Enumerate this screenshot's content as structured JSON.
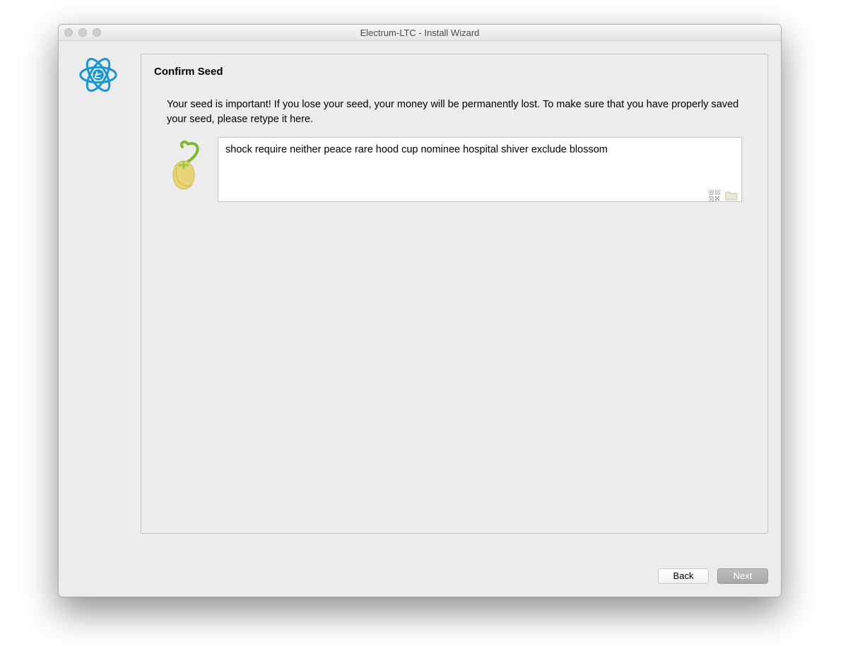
{
  "window": {
    "title": "Electrum-LTC  -  Install Wizard"
  },
  "panel": {
    "heading": "Confirm Seed",
    "description": "Your seed is important! If you lose your seed, your money will be permanently lost. To make sure that you have properly saved your seed, please retype it here."
  },
  "seed_input": {
    "value": "shock require neither peace rare hood cup nominee hospital shiver exclude blossom"
  },
  "buttons": {
    "back": "Back",
    "next": "Next"
  },
  "icons": {
    "app_logo": "electrum-ltc-logo",
    "seed": "seed-sprout-icon",
    "qr": "qr-code-icon",
    "folder": "folder-icon"
  }
}
